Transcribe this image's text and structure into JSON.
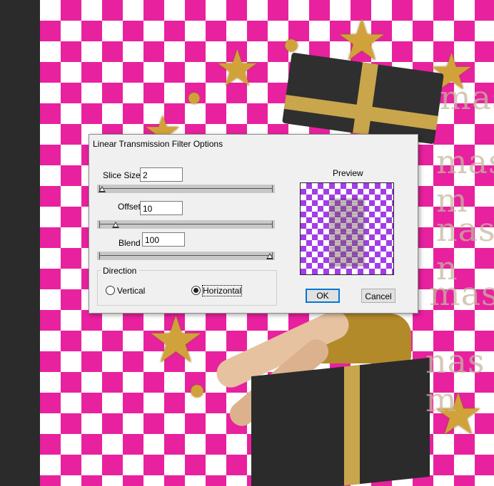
{
  "dialog": {
    "title": "Linear Transmission Filter Options",
    "slice_size": {
      "label": "Slice Size",
      "value": "2",
      "slider_fraction": 0.0
    },
    "offset": {
      "label": "Offset",
      "value": "10",
      "slider_fraction": 0.08
    },
    "blend": {
      "label": "Blend",
      "value": "100",
      "slider_fraction": 1.0
    },
    "direction": {
      "title": "Direction",
      "options": [
        {
          "label": "Vertical",
          "selected": false
        },
        {
          "label": "Horizontal",
          "selected": true
        }
      ]
    },
    "preview_label": "Preview",
    "ok_label": "OK",
    "cancel_label": "Cancel"
  },
  "background": {
    "text_fragments": [
      "mas",
      "mas m",
      "nas n",
      "mas",
      "nas m",
      "mas"
    ],
    "colors": {
      "checker": "#e8219f",
      "preview_checker": "#a23de8",
      "ribbon": "#c9a64b"
    }
  },
  "icons": [
    "star-icon",
    "glitter-circle-icon"
  ]
}
